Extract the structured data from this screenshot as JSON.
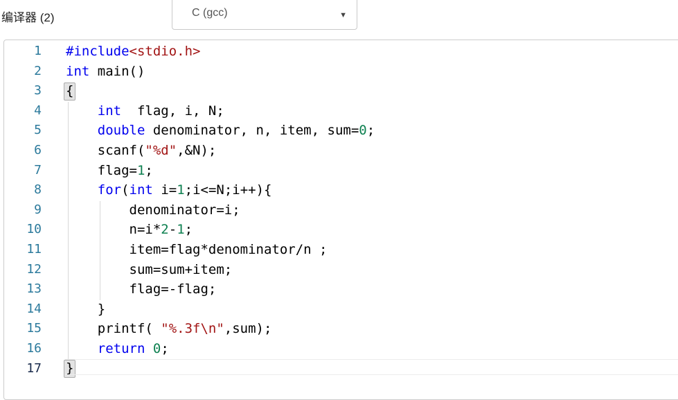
{
  "header": {
    "title": "编译器 (2)",
    "language_select": {
      "value": "C (gcc)",
      "arrow_icon": "▼"
    }
  },
  "editor": {
    "colors": {
      "keyword": "#0000ee",
      "string": "#a21515",
      "number": "#0d8050",
      "plain": "#000000",
      "line_number": "#2c7a9c",
      "line_number_active": "#1a2b4c",
      "guide": "#d8d8d8",
      "bracket_bg": "#e3e3e3",
      "bracket_border": "#ababab",
      "border": "#cccccc",
      "active_rule": "#ececec"
    },
    "lines": [
      {
        "number": "1",
        "tokens": [
          {
            "t": "kw",
            "v": "#include"
          },
          {
            "t": "str",
            "v": "<stdio.h>"
          }
        ]
      },
      {
        "number": "2",
        "tokens": [
          {
            "t": "kw",
            "v": "int"
          },
          {
            "t": "txt",
            "v": " main()"
          }
        ]
      },
      {
        "number": "3",
        "tokens": [
          {
            "t": "bracket",
            "v": "{"
          }
        ]
      },
      {
        "number": "4",
        "tokens": [
          {
            "t": "txt",
            "v": "    "
          },
          {
            "t": "kw",
            "v": "int"
          },
          {
            "t": "txt",
            "v": "  flag, i, N;"
          }
        ]
      },
      {
        "number": "5",
        "tokens": [
          {
            "t": "txt",
            "v": "    "
          },
          {
            "t": "kw",
            "v": "double"
          },
          {
            "t": "txt",
            "v": " denominator, n, item, sum="
          },
          {
            "t": "num",
            "v": "0"
          },
          {
            "t": "txt",
            "v": ";"
          }
        ]
      },
      {
        "number": "6",
        "tokens": [
          {
            "t": "txt",
            "v": "    scanf("
          },
          {
            "t": "str",
            "v": "\"%d\""
          },
          {
            "t": "txt",
            "v": ",&N);"
          }
        ]
      },
      {
        "number": "7",
        "tokens": [
          {
            "t": "txt",
            "v": "    flag="
          },
          {
            "t": "num",
            "v": "1"
          },
          {
            "t": "txt",
            "v": ";"
          }
        ]
      },
      {
        "number": "8",
        "tokens": [
          {
            "t": "txt",
            "v": "    "
          },
          {
            "t": "kw",
            "v": "for"
          },
          {
            "t": "txt",
            "v": "("
          },
          {
            "t": "kw",
            "v": "int"
          },
          {
            "t": "txt",
            "v": " i="
          },
          {
            "t": "num",
            "v": "1"
          },
          {
            "t": "txt",
            "v": ";i<=N;i++){"
          }
        ]
      },
      {
        "number": "9",
        "tokens": [
          {
            "t": "txt",
            "v": "        denominator=i;"
          }
        ]
      },
      {
        "number": "10",
        "tokens": [
          {
            "t": "txt",
            "v": "        n=i*"
          },
          {
            "t": "num",
            "v": "2"
          },
          {
            "t": "txt",
            "v": "-"
          },
          {
            "t": "num",
            "v": "1"
          },
          {
            "t": "txt",
            "v": ";"
          }
        ]
      },
      {
        "number": "11",
        "tokens": [
          {
            "t": "txt",
            "v": "        item=flag*denominator/n ;"
          }
        ]
      },
      {
        "number": "12",
        "tokens": [
          {
            "t": "txt",
            "v": "        sum=sum+item;"
          }
        ]
      },
      {
        "number": "13",
        "tokens": [
          {
            "t": "txt",
            "v": "        flag=-flag;"
          }
        ]
      },
      {
        "number": "14",
        "tokens": [
          {
            "t": "txt",
            "v": "    }"
          }
        ]
      },
      {
        "number": "15",
        "tokens": [
          {
            "t": "txt",
            "v": "    printf( "
          },
          {
            "t": "str",
            "v": "\"%.3f\\n\""
          },
          {
            "t": "txt",
            "v": ",sum);"
          }
        ]
      },
      {
        "number": "16",
        "tokens": [
          {
            "t": "txt",
            "v": "    "
          },
          {
            "t": "kw",
            "v": "return"
          },
          {
            "t": "txt",
            "v": " "
          },
          {
            "t": "num",
            "v": "0"
          },
          {
            "t": "txt",
            "v": ";"
          }
        ]
      },
      {
        "number": "17",
        "active": true,
        "tokens": [
          {
            "t": "bracket",
            "v": "}"
          }
        ]
      }
    ]
  }
}
